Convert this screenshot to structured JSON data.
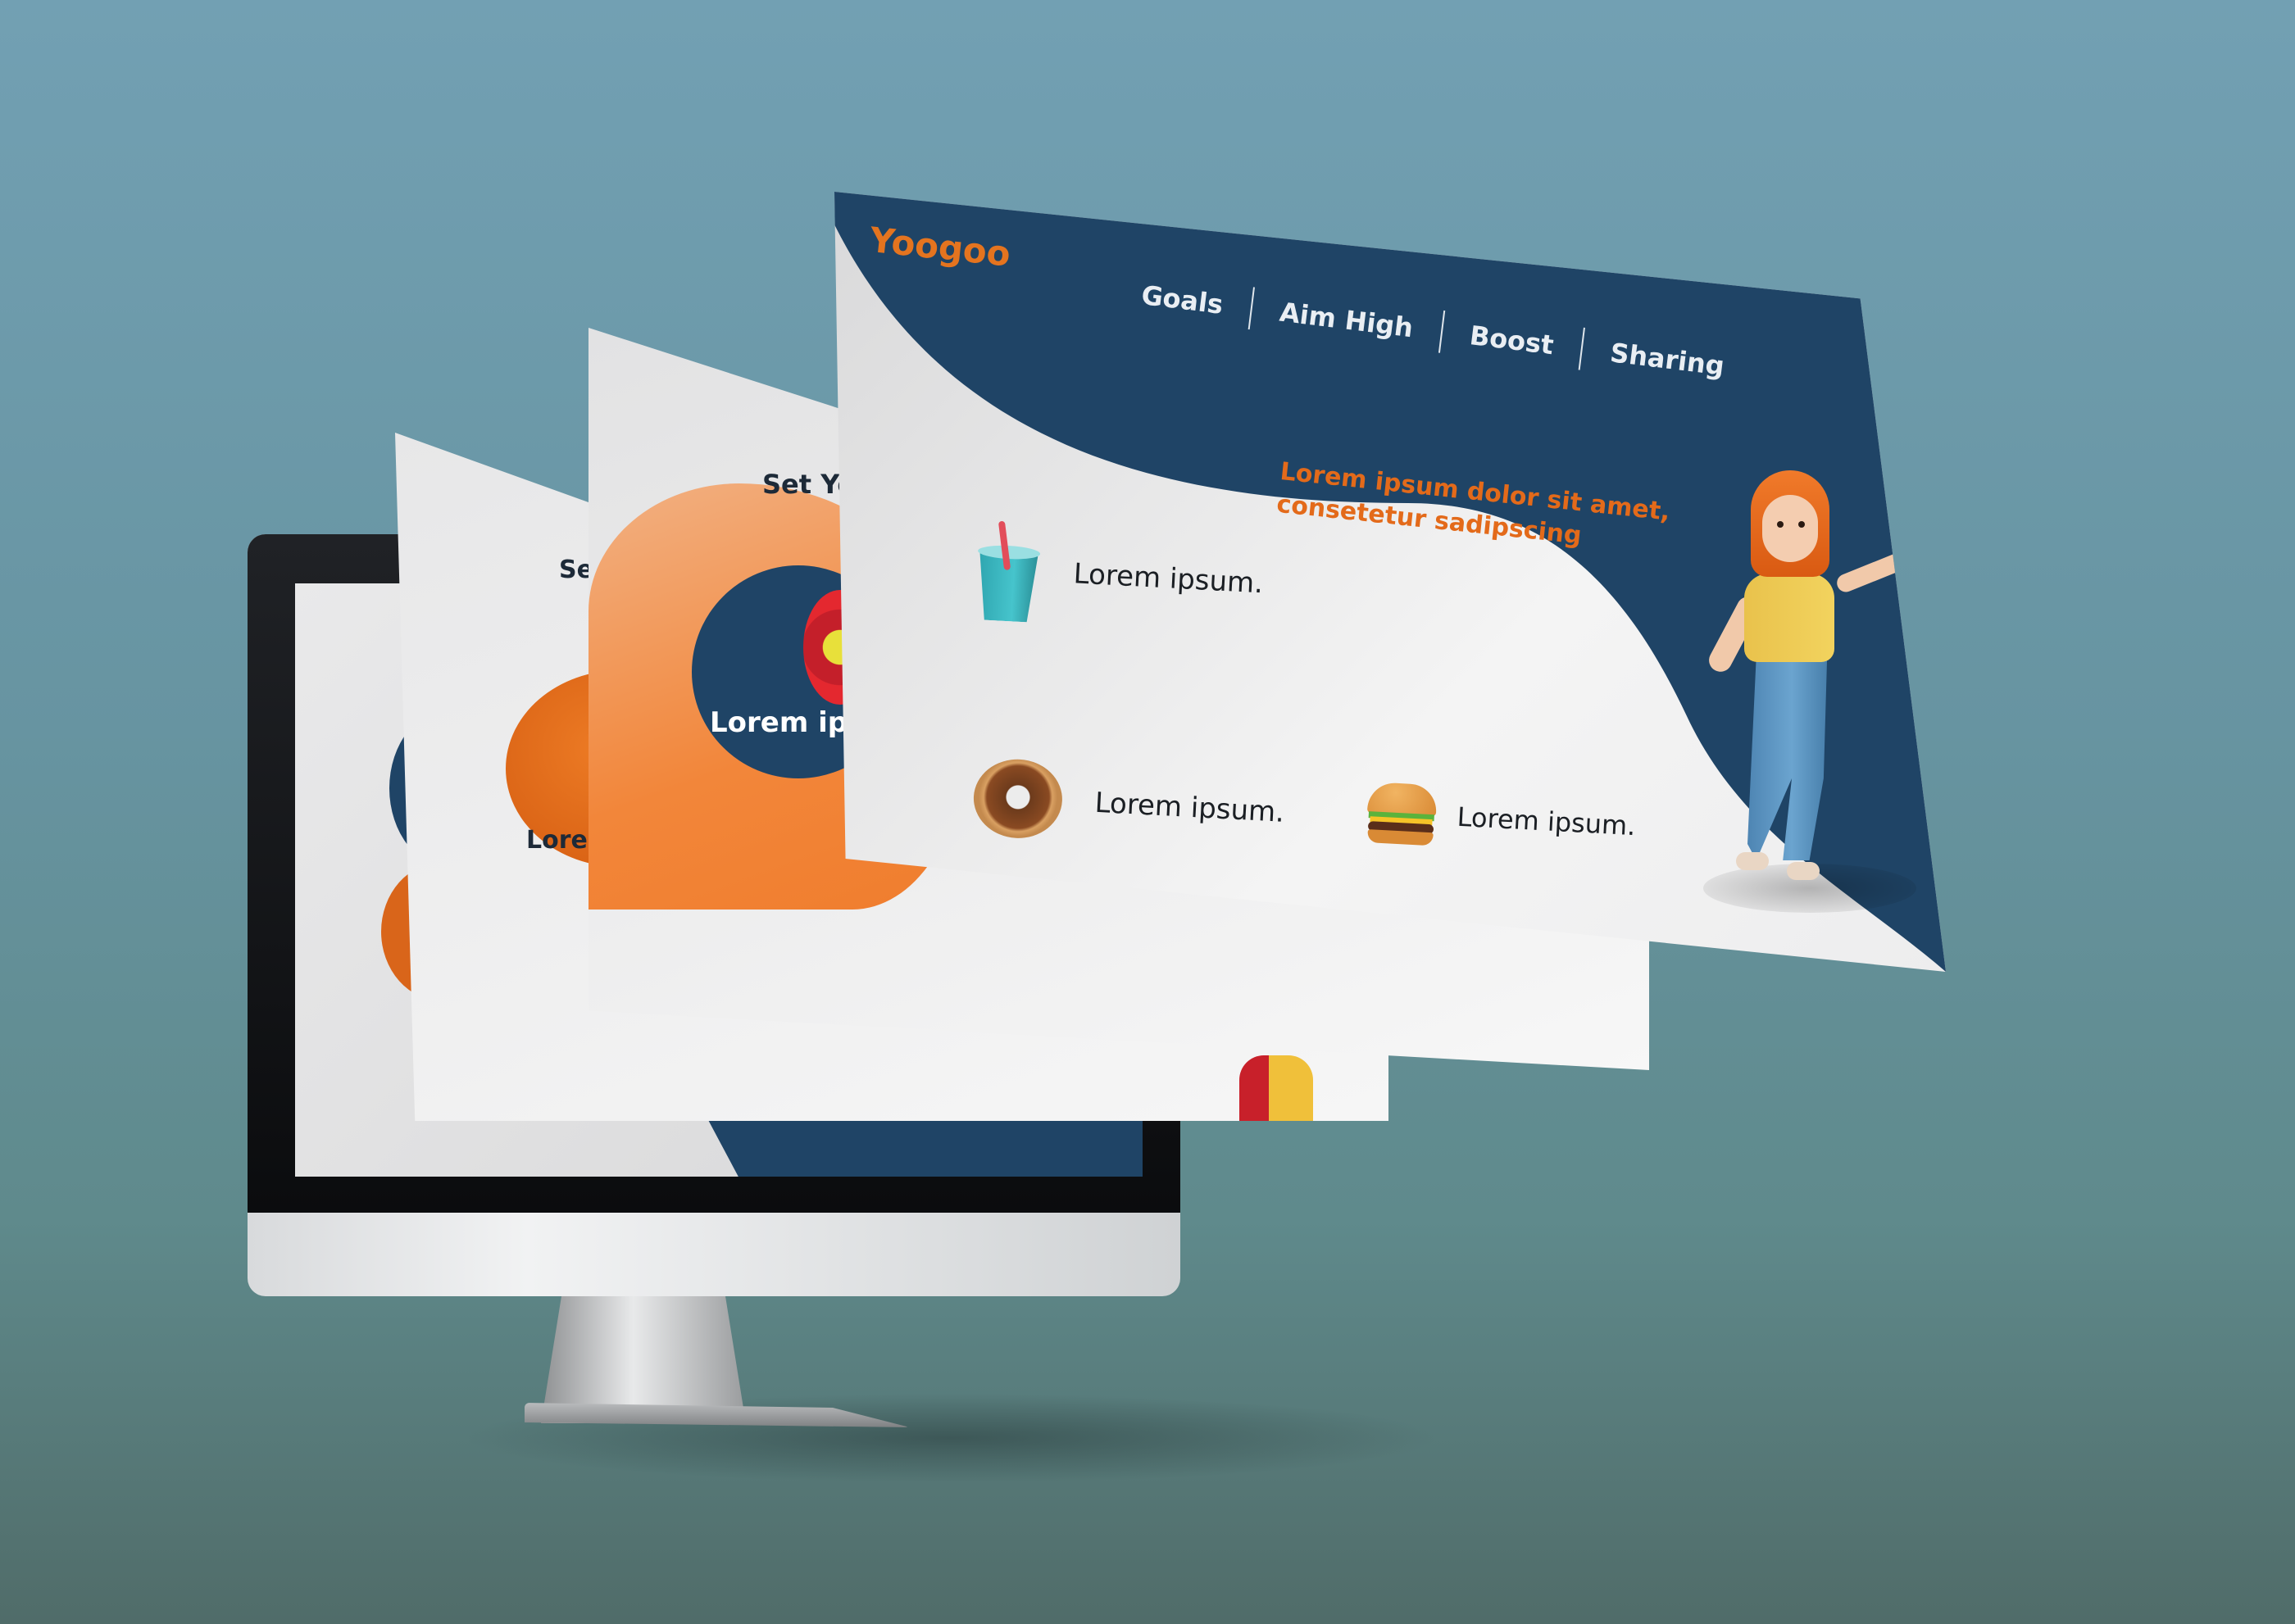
{
  "front_slide": {
    "brand": "Yoogoo",
    "nav": [
      {
        "label": "Goals"
      },
      {
        "label": "Aim High"
      },
      {
        "label": "Boost"
      },
      {
        "label": "Sharing"
      }
    ],
    "headline": "Lorem ipsum dolor sit amet, consetetur sadipscing",
    "features": [
      {
        "icon": "drink-cup-icon",
        "text": "Lorem ipsum."
      },
      {
        "icon": "donut-icon",
        "text": "Lorem ipsum."
      },
      {
        "icon": "burger-icon",
        "text": "Lorem ipsum."
      }
    ]
  },
  "middle_slide": {
    "title_partial": "Set Yo",
    "label_partial": "Lorem ips"
  },
  "back_slide": {
    "title_partial": "Se",
    "label_partial": "Loren"
  },
  "colors": {
    "background": "#6794a1",
    "navy": "#1f4466",
    "orange": "#e4741f",
    "light": "#f4f4f4"
  }
}
